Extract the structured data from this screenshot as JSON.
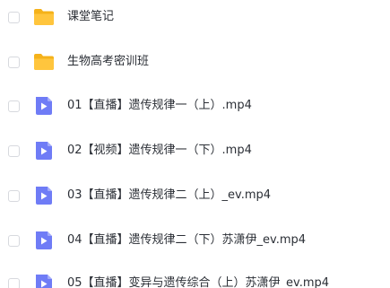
{
  "colors": {
    "folder": "#ffc53d",
    "folder_tab": "#f5b21a",
    "video": "#6f7cf6",
    "checkbox_border": "#d7d9de",
    "text": "#2b2f36"
  },
  "files": [
    {
      "type": "folder",
      "icon": "folder-icon",
      "name": "课堂笔记"
    },
    {
      "type": "folder",
      "icon": "folder-icon",
      "name": "生物高考密训班"
    },
    {
      "type": "video",
      "icon": "video-file-icon",
      "name": "01【直播】遗传规律一（上）.mp4"
    },
    {
      "type": "video",
      "icon": "video-file-icon",
      "name": "02【视频】遗传规律一（下）.mp4"
    },
    {
      "type": "video",
      "icon": "video-file-icon",
      "name": "03【直播】遗传规律二（上）_ev.mp4"
    },
    {
      "type": "video",
      "icon": "video-file-icon",
      "name": "04【直播】遗传规律二（下）苏潇伊_ev.mp4"
    },
    {
      "type": "video",
      "icon": "video-file-icon",
      "name": "05【直播】变异与遗传综合（上）苏潇伊_ev.mp4"
    }
  ]
}
